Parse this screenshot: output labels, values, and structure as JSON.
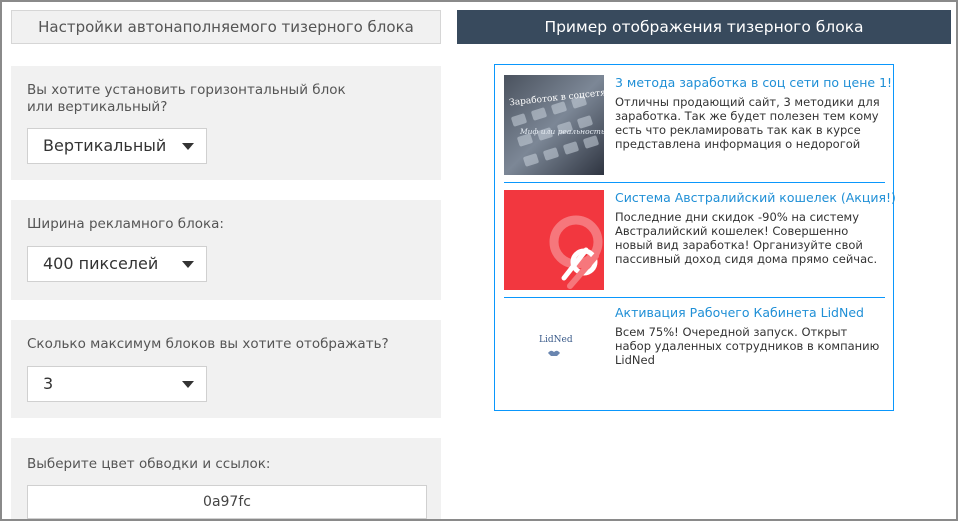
{
  "settings": {
    "header": "Настройки автонаполняемого тизерного блока",
    "orientation": {
      "label": "Вы хотите установить горизонтальный блок или вертикальный?",
      "value": "Вертикальный"
    },
    "width": {
      "label": "Ширина рекламного блока:",
      "value": "400 пикселей"
    },
    "max_blocks": {
      "label": "Сколько максимум блоков вы хотите отображать?",
      "value": "3"
    },
    "color": {
      "label": "Выберите цвет обводки и ссылок:",
      "value": "0a97fc"
    }
  },
  "preview": {
    "header": "Пример отображения тизерного блока",
    "border_color": "#0a97fc",
    "teasers": [
      {
        "title": "3 метода заработка в соц сети по цене 1!",
        "text": "Отличны продающий сайт, 3 методики для заработка. Так же будет полезен тем кому есть что рекламировать так как в курсе представлена информация о недорогой",
        "image_caption_1": "Заработок в соцсетях",
        "image_caption_2": "Миф или реальность?"
      },
      {
        "title": "Система Австралийский кошелек (Акция!)",
        "text": "Последние дни скидок -90% на систему Австралийский кошелек! Совершенно новый вид заработка! Организуйте свой пассивный доход сидя дома прямо сейчас."
      },
      {
        "title": "Активация Рабочего Кабинета LidNed",
        "text": "Всем 75%! Очередной запуск. Открыт набор удаленных сотрудников в компанию LidNed",
        "logo_text": "LidNed"
      }
    ]
  },
  "colors": {
    "accent": "#0a97fc",
    "header_dark": "#384a5d",
    "panel_bg": "#f1f1f1",
    "link": "#1f8fd6"
  }
}
